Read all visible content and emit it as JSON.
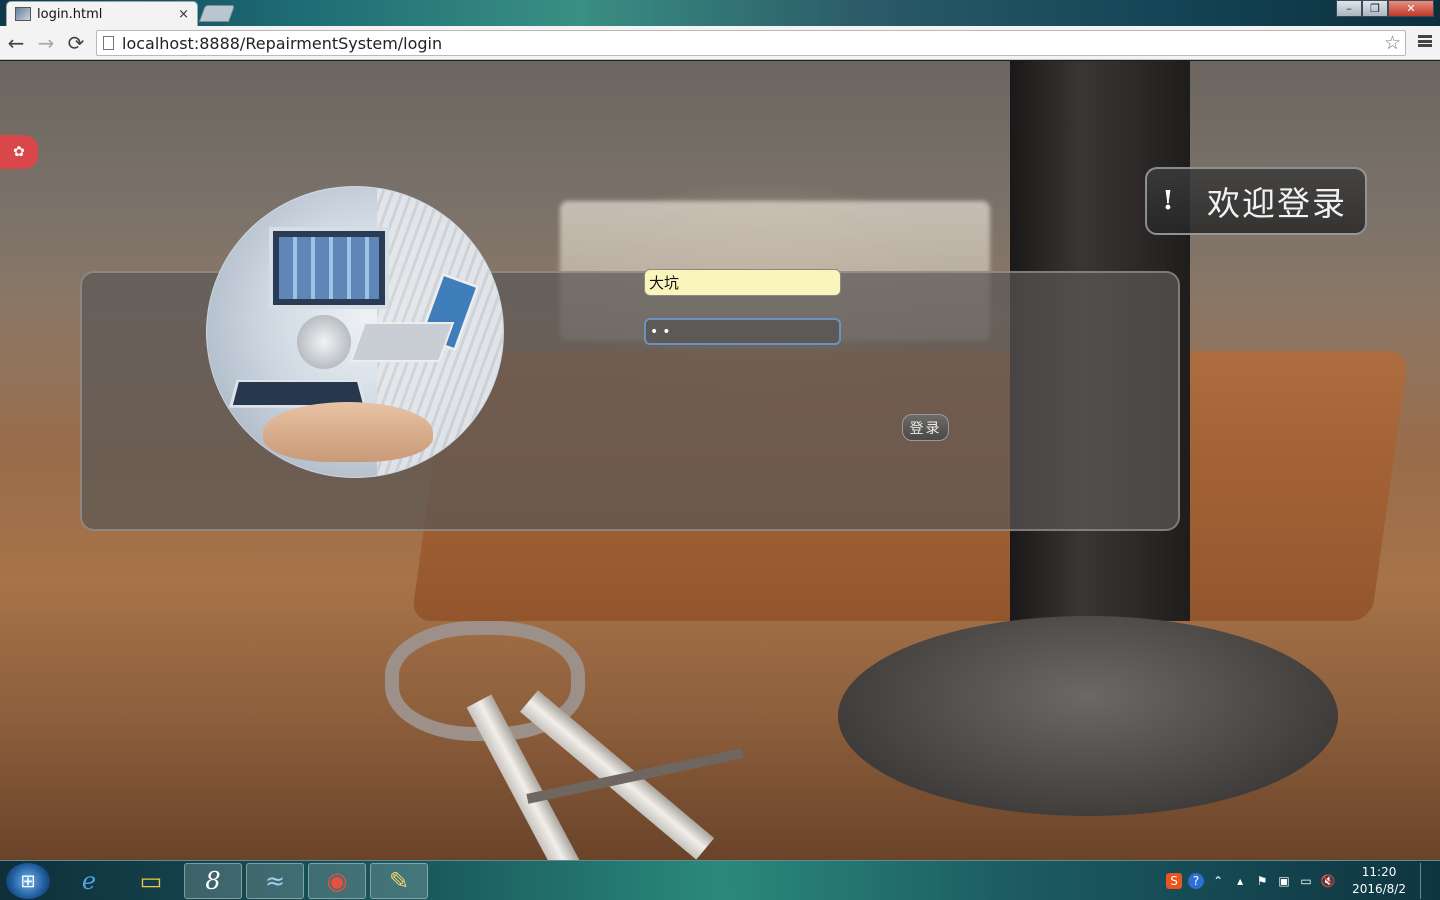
{
  "browser": {
    "tab_title": "login.html",
    "tab_close": "×",
    "url": "localhost:8888/RepairmentSystem/login",
    "star_icon": "star-icon",
    "window_buttons": {
      "minimize": "–",
      "maximize": "❐",
      "close": "✕"
    }
  },
  "nav": {
    "back": "←",
    "forward": "→",
    "reload": "⟳"
  },
  "page": {
    "settings_icon": "✿",
    "welcome_bang": "!",
    "welcome_text": "欢迎登录",
    "username_value": "大坑",
    "password_value": "••",
    "login_label": "登录"
  },
  "taskbar": {
    "start_glyph": "⊞",
    "apps": [
      {
        "name": "internet-explorer-icon",
        "glyph": "e"
      },
      {
        "name": "file-explorer-icon",
        "glyph": "▭"
      },
      {
        "name": "eclipse-icon",
        "glyph": "8"
      },
      {
        "name": "mysql-workbench-icon",
        "glyph": "≈"
      },
      {
        "name": "chrome-icon",
        "glyph": "◉"
      },
      {
        "name": "paint-icon",
        "glyph": "✎"
      }
    ],
    "tray_icons": [
      "S",
      "?",
      "⌃",
      "▴",
      "⚑",
      "▣",
      "▭",
      "🔇"
    ],
    "clock_time": "11:20",
    "clock_date": "2016/8/2"
  },
  "colors": {
    "settings_tab": "#d9474a",
    "username_bg": "#faf5bd",
    "password_border": "#6f8fc4"
  }
}
